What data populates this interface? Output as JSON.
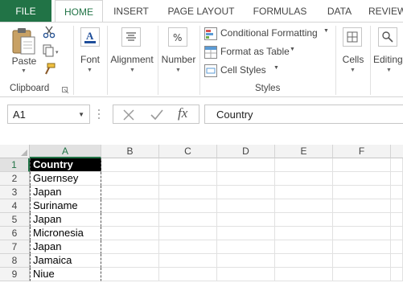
{
  "ribbon": {
    "tabs": [
      {
        "label": "FILE"
      },
      {
        "label": "HOME"
      },
      {
        "label": "INSERT"
      },
      {
        "label": "PAGE LAYOUT"
      },
      {
        "label": "FORMULAS"
      },
      {
        "label": "DATA"
      },
      {
        "label": "REVIEW"
      }
    ],
    "active_tab": "HOME",
    "clipboard": {
      "paste_label": "Paste",
      "group_label": "Clipboard"
    },
    "font": {
      "label": "Font"
    },
    "alignment": {
      "label": "Alignment"
    },
    "number": {
      "label": "Number"
    },
    "styles": {
      "conditional_formatting": "Conditional Formatting",
      "format_as_table": "Format as Table",
      "cell_styles": "Cell Styles",
      "group_label": "Styles"
    },
    "cells": {
      "label": "Cells"
    },
    "editing": {
      "label": "Editing"
    },
    "accent_color": "#217346"
  },
  "formula_bar": {
    "name_box": "A1",
    "fx_label": "fx",
    "content": "Country"
  },
  "sheet": {
    "columns": [
      "A",
      "B",
      "C",
      "D",
      "E",
      "F"
    ],
    "rows": [
      "1",
      "2",
      "3",
      "4",
      "5",
      "6",
      "7",
      "8",
      "9"
    ],
    "col_a_values": [
      "Country",
      "Guernsey",
      "Japan",
      "Suriname",
      "Japan",
      "Micronesia",
      "Japan",
      "Jamaica",
      "Niue"
    ],
    "selected_cell": "A1"
  }
}
